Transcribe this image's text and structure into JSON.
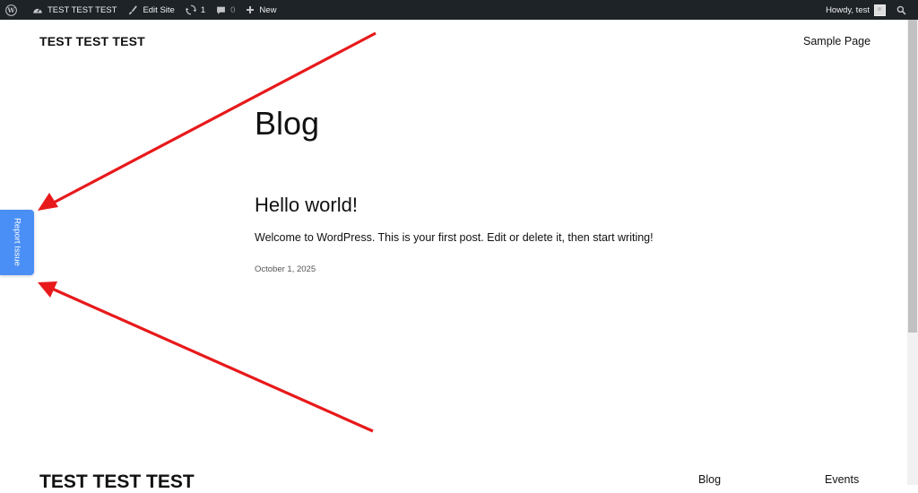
{
  "admin_bar": {
    "site_name": "TEST TEST TEST",
    "edit_site": "Edit Site",
    "updates_count": "1",
    "comments_count": "0",
    "new_label": "New",
    "howdy": "Howdy, test"
  },
  "header": {
    "site_title": "TEST TEST TEST",
    "nav_sample_page": "Sample Page"
  },
  "main": {
    "page_title": "Blog",
    "post": {
      "title": "Hello world!",
      "excerpt": "Welcome to WordPress. This is your first post. Edit or delete it, then start writing!",
      "date": "October 1, 2025"
    }
  },
  "report_tab": {
    "label": "Report Issue"
  },
  "footer": {
    "site_title": "TEST TEST TEST",
    "nav_blog": "Blog",
    "nav_events": "Events"
  },
  "colors": {
    "admin_bar": "#1d2327",
    "report_tab": "#4a8ff5",
    "annotation_arrow": "#e8191b"
  },
  "icons": [
    "wordpress-icon",
    "dashboard-icon",
    "edit-brush-icon",
    "updates-icon",
    "comment-icon",
    "plus-icon",
    "search-icon"
  ]
}
